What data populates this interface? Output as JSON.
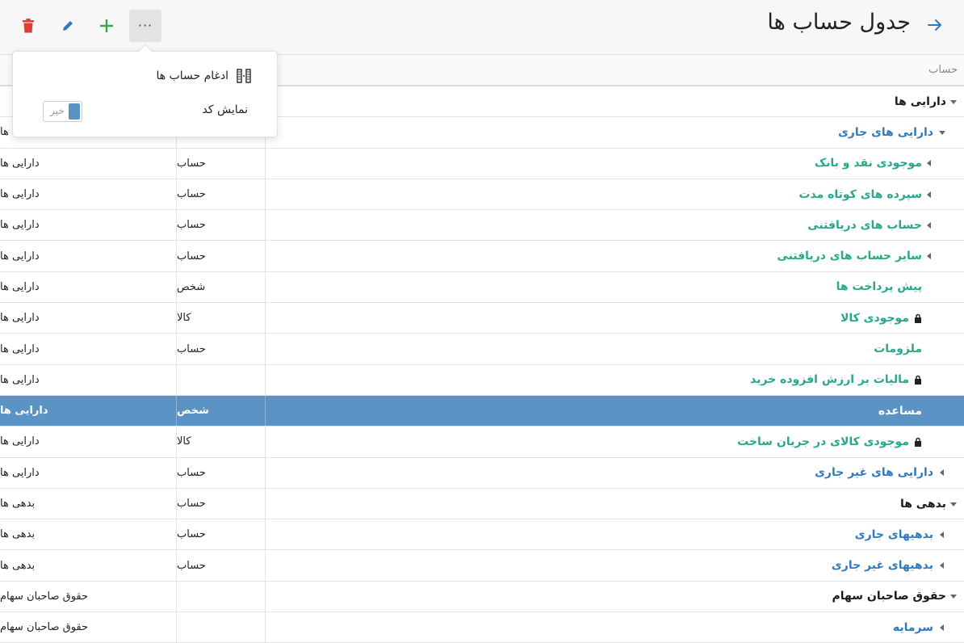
{
  "header": {
    "title": "جدول حساب ها",
    "icons": [
      "arrow-right-icon",
      "more-icon",
      "plus-icon",
      "pencil-icon",
      "trash-icon"
    ],
    "more_label": "···"
  },
  "column_header": {
    "account_label": "حساب"
  },
  "popup": {
    "merge_label": "ادغام حساب ها",
    "show_code_label": "نمایش کد",
    "show_code_value": "خیر"
  },
  "colors": {
    "accent": "#2f79be",
    "leaf": "#27a889",
    "selected": "#5b93c5",
    "add": "#3aa64a",
    "delete": "#d9403a"
  },
  "rows": [
    {
      "name": "دارایی ها",
      "type": "",
      "group": ""
    },
    {
      "name": "دارایی های جاری",
      "type": "حساب",
      "group": "دارایی ها"
    },
    {
      "name": "موجودی نقد و بانک",
      "type": "حساب",
      "group": "دارایی ها"
    },
    {
      "name": "سپرده های کوتاه مدت",
      "type": "حساب",
      "group": "دارایی ها"
    },
    {
      "name": "حساب های دریافتنی",
      "type": "حساب",
      "group": "دارایی ها"
    },
    {
      "name": "سایر حساب های دریافتنی",
      "type": "حساب",
      "group": "دارایی ها"
    },
    {
      "name": "پیش پرداخت ها",
      "type": "شخص",
      "group": "دارایی ها"
    },
    {
      "name": "موجودی کالا",
      "type": "کالا",
      "group": "دارایی ها"
    },
    {
      "name": "ملزومات",
      "type": "حساب",
      "group": "دارایی ها"
    },
    {
      "name": "مالیات بر ارزش افزوده خرید",
      "type": "",
      "group": "دارایی ها"
    },
    {
      "name": "مساعده",
      "type": "شخص",
      "group": "دارایی ها"
    },
    {
      "name": "موجودی کالای در جریان ساخت",
      "type": "کالا",
      "group": "دارایی ها"
    },
    {
      "name": "دارایی های غیر جاری",
      "type": "حساب",
      "group": "دارایی ها"
    },
    {
      "name": "بدهی ها",
      "type": "حساب",
      "group": "بدهی ها"
    },
    {
      "name": "بدهیهای جاری",
      "type": "حساب",
      "group": "بدهی ها"
    },
    {
      "name": "بدهیهای غیر جاری",
      "type": "حساب",
      "group": "بدهی ها"
    },
    {
      "name": "حقوق صاحبان سهام",
      "type": "",
      "group": "حقوق صاحبان سهام"
    },
    {
      "name": "سرمایه",
      "type": "",
      "group": "حقوق صاحبان سهام"
    }
  ]
}
